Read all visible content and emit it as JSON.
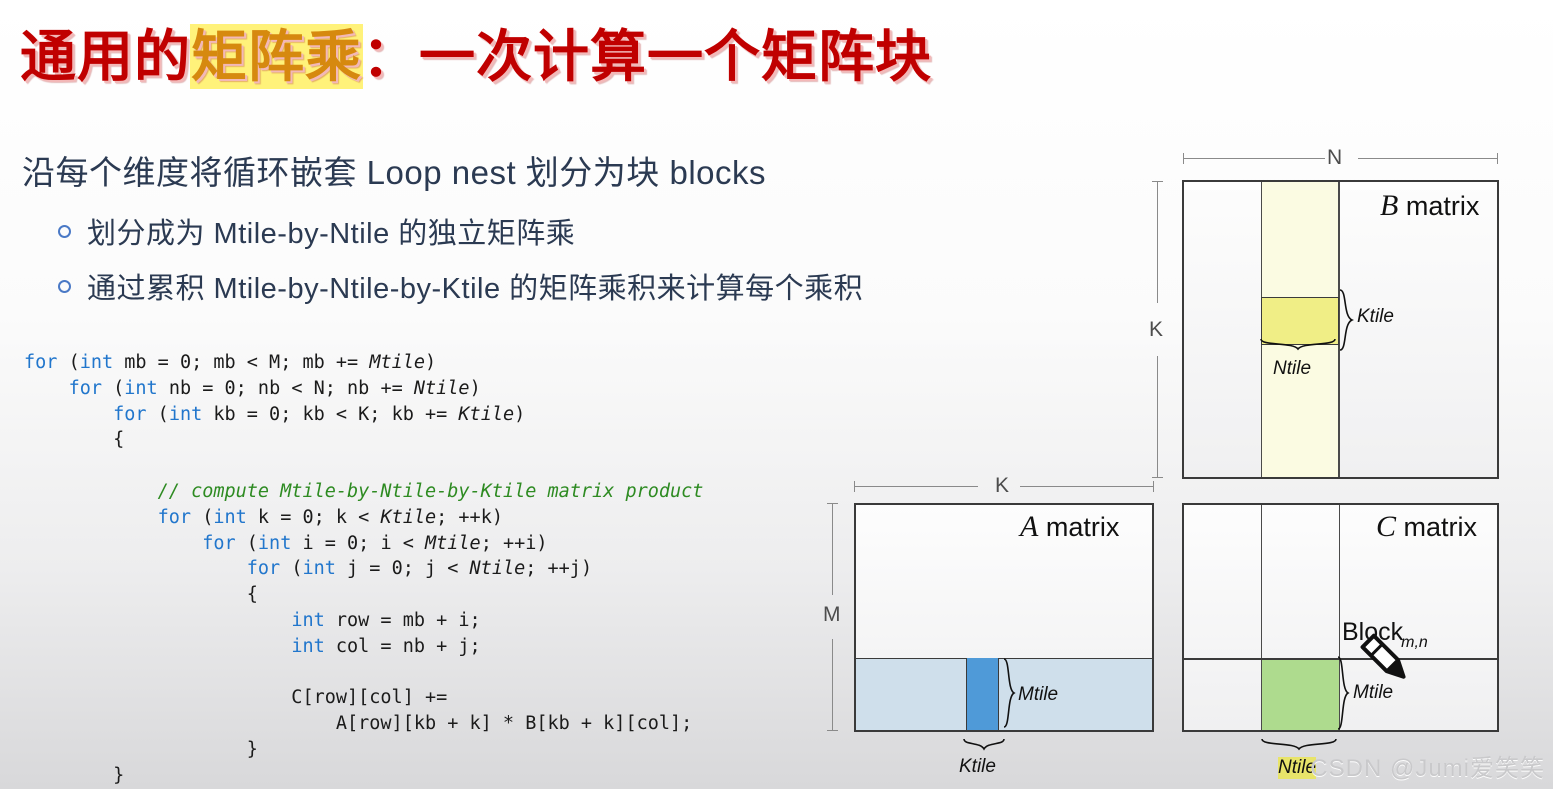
{
  "slide": {
    "title_before": "通用的",
    "title_highlight": "矩阵乘",
    "title_after": "：一次计算一个矩阵块",
    "lead": "沿每个维度将循环嵌套 Loop nest 划分为块 blocks",
    "bullets": [
      "划分成为 Mtile-by-Ntile 的独立矩阵乘",
      "通过累积 Mtile-by-Ntile-by-Ktile 的矩阵乘积来计算每个乘积"
    ],
    "watermark": "CSDN @Jumi爱笑笑"
  },
  "code": {
    "lines": [
      [
        {
          "t": "for ",
          "c": "kw"
        },
        {
          "t": "(",
          "c": ""
        },
        {
          "t": "int",
          "c": "kw"
        },
        {
          "t": " mb = 0; mb < M; mb += ",
          "c": ""
        },
        {
          "t": "Mtile",
          "c": "it"
        },
        {
          "t": ")",
          "c": ""
        }
      ],
      [
        {
          "t": "    ",
          "c": ""
        },
        {
          "t": "for ",
          "c": "kw"
        },
        {
          "t": "(",
          "c": ""
        },
        {
          "t": "int",
          "c": "kw"
        },
        {
          "t": " nb = 0; nb < N; nb += ",
          "c": ""
        },
        {
          "t": "Ntile",
          "c": "it"
        },
        {
          "t": ")",
          "c": ""
        }
      ],
      [
        {
          "t": "        ",
          "c": ""
        },
        {
          "t": "for ",
          "c": "kw"
        },
        {
          "t": "(",
          "c": ""
        },
        {
          "t": "int",
          "c": "kw"
        },
        {
          "t": " kb = 0; kb < K; kb += ",
          "c": ""
        },
        {
          "t": "Ktile",
          "c": "it"
        },
        {
          "t": ")",
          "c": ""
        }
      ],
      [
        {
          "t": "        {",
          "c": ""
        }
      ],
      [
        {
          "t": "",
          "c": ""
        }
      ],
      [
        {
          "t": "            ",
          "c": ""
        },
        {
          "t": "// compute Mtile-by-Ntile-by-Ktile matrix product",
          "c": "cmt"
        }
      ],
      [
        {
          "t": "            ",
          "c": ""
        },
        {
          "t": "for ",
          "c": "kw"
        },
        {
          "t": "(",
          "c": ""
        },
        {
          "t": "int",
          "c": "kw"
        },
        {
          "t": " k = 0; k < ",
          "c": ""
        },
        {
          "t": "Ktile",
          "c": "it"
        },
        {
          "t": "; ++k)",
          "c": ""
        }
      ],
      [
        {
          "t": "                ",
          "c": ""
        },
        {
          "t": "for ",
          "c": "kw"
        },
        {
          "t": "(",
          "c": ""
        },
        {
          "t": "int",
          "c": "kw"
        },
        {
          "t": " i = 0; i < ",
          "c": ""
        },
        {
          "t": "Mtile",
          "c": "it"
        },
        {
          "t": "; ++i)",
          "c": ""
        }
      ],
      [
        {
          "t": "                    ",
          "c": ""
        },
        {
          "t": "for ",
          "c": "kw"
        },
        {
          "t": "(",
          "c": ""
        },
        {
          "t": "int",
          "c": "kw"
        },
        {
          "t": " j = 0; j < ",
          "c": ""
        },
        {
          "t": "Ntile",
          "c": "it"
        },
        {
          "t": "; ++j)",
          "c": ""
        }
      ],
      [
        {
          "t": "                    {",
          "c": ""
        }
      ],
      [
        {
          "t": "                        ",
          "c": ""
        },
        {
          "t": "int",
          "c": "kw"
        },
        {
          "t": " row = mb + i;",
          "c": ""
        }
      ],
      [
        {
          "t": "                        ",
          "c": ""
        },
        {
          "t": "int",
          "c": "kw"
        },
        {
          "t": " col = nb + j;",
          "c": ""
        }
      ],
      [
        {
          "t": "",
          "c": ""
        }
      ],
      [
        {
          "t": "                        C[row][col] +=",
          "c": ""
        }
      ],
      [
        {
          "t": "                            A[row][kb + k] * B[kb + k][col];",
          "c": ""
        }
      ],
      [
        {
          "t": "                    }",
          "c": ""
        }
      ],
      [
        {
          "t": "        }",
          "c": ""
        }
      ]
    ]
  },
  "diagram": {
    "b_matrix": {
      "name": "B matrix",
      "dim_top": "N",
      "dim_left": "K",
      "tile_k": "Ktile",
      "tile_n": "Ntile"
    },
    "a_matrix": {
      "name": "A matrix",
      "dim_top": "K",
      "dim_left": "M",
      "tile_m": "Mtile",
      "tile_k": "Ktile"
    },
    "c_matrix": {
      "name": "C matrix",
      "block_label": "Block",
      "block_sub": "m,n",
      "tile_m": "Mtile",
      "tile_n": "Ntile"
    }
  },
  "colors": {
    "title_red": "#c00000",
    "title_highlight": "#fff27a",
    "body_text": "#2b3a52",
    "code_keyword": "#2176cc",
    "code_comment": "#2e8b22",
    "b_strip": "#fbfbe2",
    "b_tile": "#f0ee86",
    "a_strip": "#cfdfeb",
    "a_tile": "#4f9ad8",
    "c_tile": "#aedb8e"
  }
}
